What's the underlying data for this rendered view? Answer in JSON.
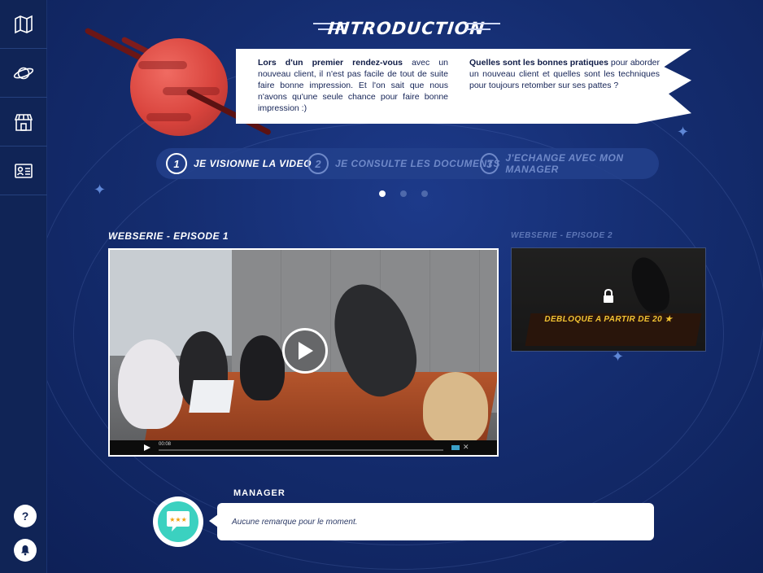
{
  "sidebar": {
    "items": [
      {
        "icon": "map-icon"
      },
      {
        "icon": "planet-icon"
      },
      {
        "icon": "store-icon"
      },
      {
        "icon": "id-card-icon"
      }
    ],
    "help_label": "?",
    "notifications_icon": "bell-icon"
  },
  "header": {
    "title": "INTRODUCTION"
  },
  "intro": {
    "left_bold": "Lors d'un premier rendez-vous",
    "left_text": " avec un nouveau client, il n'est pas facile de tout de suite faire bonne impression. Et l'on sait que nous n'avons qu'une seule chance pour faire bonne impression :)",
    "right_bold": "Quelles sont les bonnes pratiques",
    "right_text": " pour aborder un nouveau client et quelles sont les techniques pour toujours retomber sur ses pattes ?"
  },
  "steps": [
    {
      "num": "1",
      "label": "JE VISIONNE LA VIDEO",
      "active": true
    },
    {
      "num": "2",
      "label": "JE CONSULTE LES DOCUMENTS",
      "active": false
    },
    {
      "num": "3",
      "label": "J'ECHANGE AVEC MON MANAGER",
      "active": false
    }
  ],
  "pagination": {
    "current": 1,
    "total": 3
  },
  "episodes": {
    "main_label": "WEBSERIE - EPISODE 1",
    "main_time": "00:08",
    "side_label": "WEBSERIE - EPISODE 2",
    "side_unlock": "DEBLOQUE A PARTIR DE 20 ★"
  },
  "manager": {
    "label": "MANAGER",
    "comment": "Aucune remarque pour le moment."
  },
  "colors": {
    "background": "#142c6e",
    "sidebar": "#102456",
    "accent_teal": "#3bd1c0",
    "planet_red": "#d9443d",
    "unlock_yellow": "#f1c232"
  }
}
